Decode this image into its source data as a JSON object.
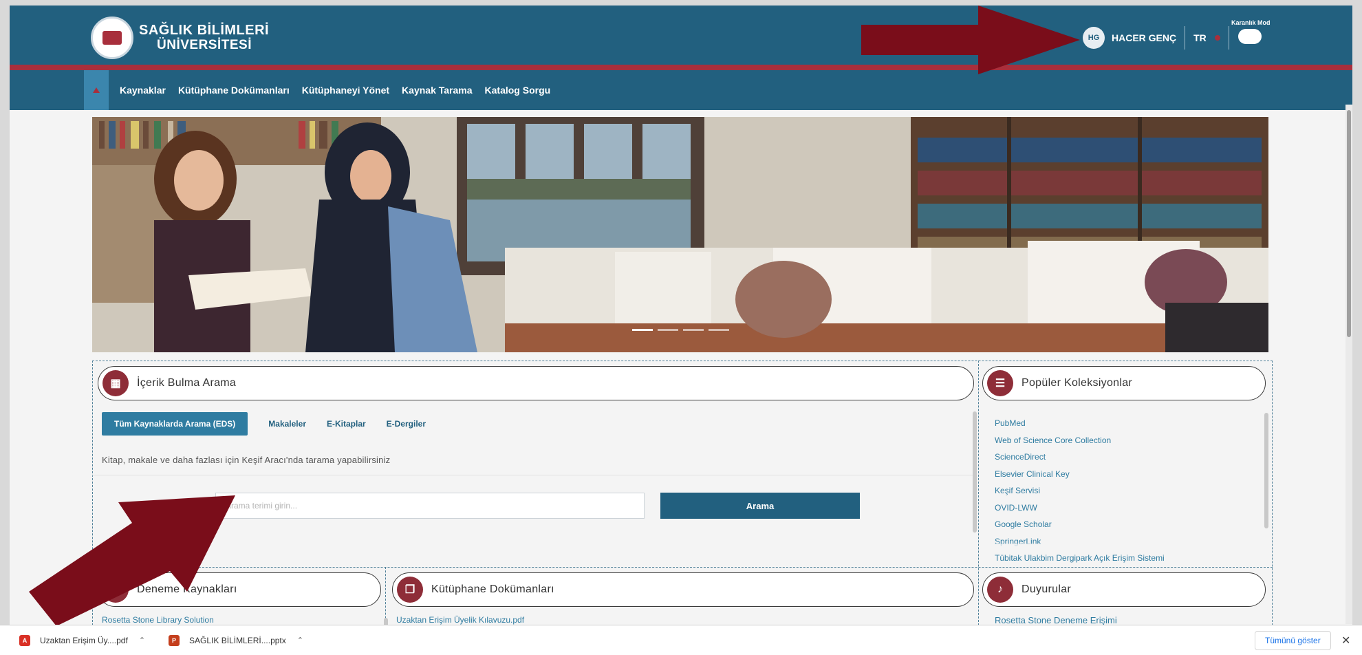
{
  "header": {
    "logo_line1": "SAĞLIK BİLİMLERİ",
    "logo_line2": "ÜNİVERSİTESİ",
    "avatar_initials": "HG",
    "user_name": "HACER GENÇ",
    "language": "TR",
    "dark_mode_label": "Karanlık Mod"
  },
  "nav": {
    "items": [
      "Kaynaklar",
      "Kütüphane Dokümanları",
      "Kütüphaneyi Yönet",
      "Kaynak Tarama",
      "Katalog Sorgu"
    ]
  },
  "search_panel": {
    "title": "İçerik Bulma Arama",
    "tabs": [
      "Tüm Kaynaklarda Arama (EDS)",
      "Makaleler",
      "E-Kitaplar",
      "E-Dergiler"
    ],
    "hint": "Kitap, makale ve daha fazlası için Keşif Aracı'nda tarama yapabilirsiniz",
    "input_placeholder": "Arama terimi girin...",
    "button_label": "Arama"
  },
  "collections_panel": {
    "title": "Popüler Koleksiyonlar",
    "items": [
      "PubMed",
      "Web of Science Core Collection",
      "ScienceDirect",
      "Elsevier Clinical Key",
      "Keşif Servisi",
      "OVID-LWW",
      "Google Scholar",
      "SpringerLink",
      "Tübitak Ulakbim Dergipark Açık Erişim Sistemi"
    ]
  },
  "trial_panel": {
    "title": "Deneme Kaynakları",
    "first_item": "Rosetta Stone Library Solution"
  },
  "docs_panel": {
    "title": "Kütüphane Dokümanları",
    "first_item": "Uzaktan Erişim Üyelik Kılavuzu.pdf"
  },
  "announcements_panel": {
    "title": "Duyurular",
    "first_item": "Rosetta Stone Deneme Erişimi"
  },
  "downloads": {
    "items": [
      {
        "name": "Uzaktan Erişim Üy....pdf",
        "type": "pdf",
        "color": "#d93025"
      },
      {
        "name": "SAĞLIK BİLİMLERİ....pptx",
        "type": "pptx",
        "color": "#c43e1c"
      }
    ],
    "show_all": "Tümünü göster"
  },
  "colors": {
    "primary": "#22607f",
    "accent": "#a82f3c",
    "arrow": "#7a0d1a"
  }
}
